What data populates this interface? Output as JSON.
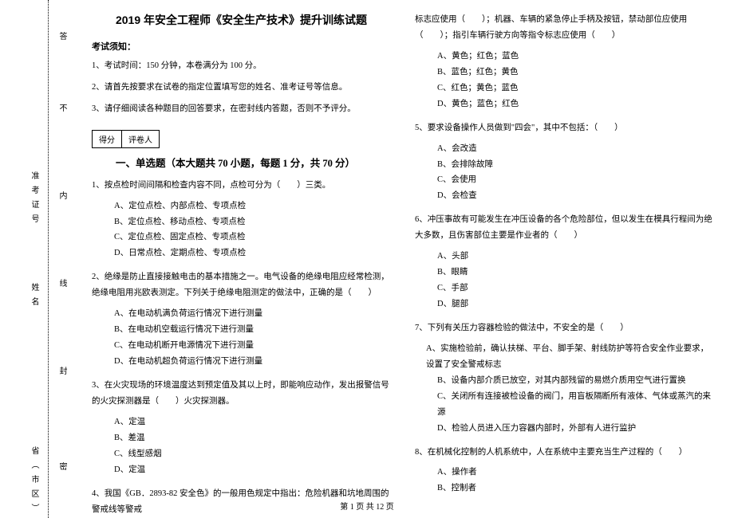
{
  "binding": {
    "field1": "省（市区）",
    "field2": "姓名",
    "field3": "准考证号",
    "seal1": "密",
    "seal2": "封",
    "seal3": "线",
    "seal4": "内",
    "seal5": "不",
    "seal6": "答"
  },
  "header": {
    "title": "2019 年安全工程师《安全生产技术》提升训练试题",
    "notice_label": "考试须知：",
    "instruction1": "1、考试时间：150 分钟，本卷满分为 100 分。",
    "instruction2": "2、请首先按要求在试卷的指定位置填写您的姓名、准考证号等信息。",
    "instruction3": "3、请仔细阅读各种题目的回答要求，在密封线内答题，否则不予评分。"
  },
  "scorebox": {
    "cell1": "得分",
    "cell2": "评卷人"
  },
  "section1": {
    "title": "一、单选题（本大题共 70 小题，每题 1 分，共 70 分）"
  },
  "q1": {
    "text": "1、按点检时间间隔和检查内容不同，点检可分为（　　）三类。",
    "a": "A、定位点检、内部点检、专项点检",
    "b": "B、定位点检、移动点检、专项点检",
    "c": "C、定位点检、固定点检、专项点检",
    "d": "D、日常点检、定期点检、专项点检"
  },
  "q2": {
    "text": "2、绝缘是防止直接接触电击的基本措施之一。电气设备的绝缘电阻应经常检测，绝缘电阻用兆欧表测定。下列关于绝缘电阻测定的做法中，正确的是（　　）",
    "a": "A、在电动机满负荷运行情况下进行测量",
    "b": "B、在电动机空载运行情况下进行测量",
    "c": "C、在电动机断开电源情况下进行测量",
    "d": "D、在电动机超负荷运行情况下进行测量"
  },
  "q3": {
    "text": "3、在火灾现场的环境温度达到预定值及其以上时，即能响应动作，发出报警信号的火灾探测器是（　　）火灾探测器。",
    "a": "A、定温",
    "b": "B、差温",
    "c": "C、线型感烟",
    "d": "D、定温"
  },
  "q4": {
    "text_part1": "4、我国《GB．2893-82 安全色》的一般用色规定中指出：危险机器和坑地周围的警戒线等警戒",
    "text_part2": "标志应使用（　　）；机器、车辆的紧急停止手柄及按钮，禁动部位应使用（　　）；指引车辆行驶方向等指令标志应使用（　　）",
    "a": "A、黄色；红色；蓝色",
    "b": "B、蓝色；红色；黄色",
    "c": "C、红色；黄色；蓝色",
    "d": "D、黄色；蓝色；红色"
  },
  "q5": {
    "text": "5、要求设备操作人员做到\"四会\"，其中不包括：（　　）",
    "a": "A、会改造",
    "b": "B、会排除故障",
    "c": "C、会使用",
    "d": "D、会检查"
  },
  "q6": {
    "text": "6、冲压事故有可能发生在冲压设备的各个危险部位，但以发生在模具行程间为绝大多数，且伤害部位主要是作业者的（　　）",
    "a": "A、头部",
    "b": "B、眼睛",
    "c": "C、手部",
    "d": "D、腿部"
  },
  "q7": {
    "text": "7、下列有关压力容器检验的做法中，不安全的是（　　）",
    "a": "A、实施检验前，确认扶梯、平台、脚手架、射线防护等符合安全作业要求，设置了安全警戒标志",
    "b": "B、设备内部介质已放空，对其内部残留的易燃介质用空气进行置换",
    "c": "C、关闭所有连接被检设备的阀门，用盲板隔断所有液体、气体或蒸汽的来源",
    "d": "D、检验人员进入压力容器内部时，外部有人进行监护"
  },
  "q8": {
    "text": "8、在机械化控制的人机系统中，人在系统中主要充当生产过程的（　　）",
    "a": "A、操作者",
    "b": "B、控制者"
  },
  "footer": {
    "text": "第 1 页 共 12 页"
  }
}
